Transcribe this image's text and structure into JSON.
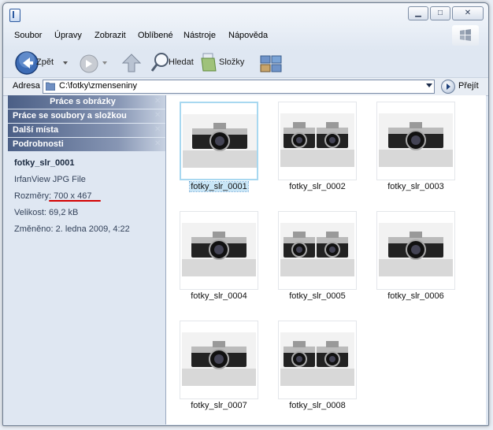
{
  "menu": [
    "Soubor",
    "Úpravy",
    "Zobrazit",
    "Oblíbené",
    "Nástroje",
    "Nápověda"
  ],
  "toolbar": {
    "back_label": "Zpět",
    "search_label": "Hledat",
    "folders_label": "Složky"
  },
  "address": {
    "label": "Adresa",
    "value": "C:\\fotky\\zmenseniny",
    "go_label": "Přejít"
  },
  "sidebar": {
    "panes": [
      "Práce s obrázky",
      "Práce se soubory a složkou",
      "Další místa",
      "Podrobnosti"
    ],
    "details": {
      "name": "fotky_slr_0001",
      "type": "IrfanView JPG File",
      "dimensions": "Rozměry: 700 x 467",
      "size": "Velikost: 69,2 kB",
      "modified": "Změněno: 2. ledna 2009, 4:22"
    }
  },
  "files": [
    "fotky_slr_0001",
    "fotky_slr_0002",
    "fotky_slr_0003",
    "fotky_slr_0004",
    "fotky_slr_0005",
    "fotky_slr_0006",
    "fotky_slr_0007",
    "fotky_slr_0008"
  ],
  "selected_file": "fotky_slr_0001"
}
